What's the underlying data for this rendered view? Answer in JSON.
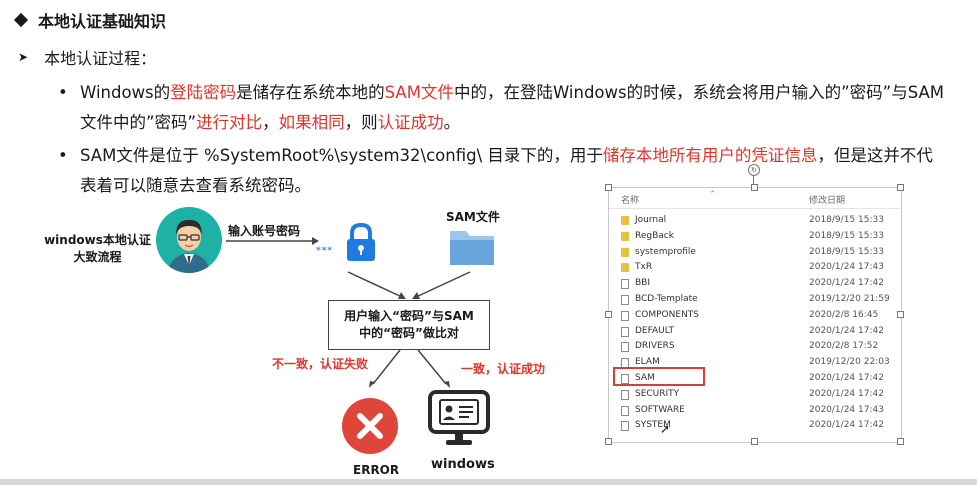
{
  "heading": "本地认证基础知识",
  "subheading": "本地认证过程：",
  "bullet1": {
    "p1": "Windows的",
    "p2": "登陆密码",
    "p3": "是储存在系统本地的",
    "p4": "SAM文件",
    "p5": "中的，在登陆Windows的时候，系统会将用户输入的”密码”与SAM文件中的”密码”",
    "p6": "进行对比",
    "p7": "，",
    "p8": "如果相同",
    "p9": "，则",
    "p10": "认证成功",
    "p11": "。"
  },
  "bullet2": {
    "p1": "SAM文件是位于 %SystemRoot%\\system32\\config\\ 目录下的，用于",
    "p2": "储存本地所有用户的凭证信息",
    "p3": "，但是这并不代表着可以随意去查看系统密码。"
  },
  "diagram": {
    "flow_label_1": "windows本地认证",
    "flow_label_2": "大致流程",
    "input_label": "输入账号密码",
    "password_dots": "***",
    "sam_label": "SAM文件",
    "compare_line1": "用户输入“密码”与SAM",
    "compare_line2": "中的“密码”做比对",
    "fail_label": "不一致，认证失败",
    "success_label": "一致，认证成功",
    "error_label": "ERROR",
    "windows_label": "windows"
  },
  "explorer": {
    "col_name": "名称",
    "col_date": "修改日期",
    "rows": [
      {
        "name": "Journal",
        "date": "2018/9/15 15:33",
        "type": "folder"
      },
      {
        "name": "RegBack",
        "date": "2018/9/15 15:33",
        "type": "folder"
      },
      {
        "name": "systemprofile",
        "date": "2018/9/15 15:33",
        "type": "folder"
      },
      {
        "name": "TxR",
        "date": "2020/1/24 17:43",
        "type": "folder"
      },
      {
        "name": "BBI",
        "date": "2020/1/24 17:42",
        "type": "file"
      },
      {
        "name": "BCD-Template",
        "date": "2019/12/20 21:59",
        "type": "file"
      },
      {
        "name": "COMPONENTS",
        "date": "2020/2/8 16:45",
        "type": "file"
      },
      {
        "name": "DEFAULT",
        "date": "2020/1/24 17:42",
        "type": "file"
      },
      {
        "name": "DRIVERS",
        "date": "2020/2/8 17:52",
        "type": "file"
      },
      {
        "name": "ELAM",
        "date": "2019/12/20 22:03",
        "type": "file"
      },
      {
        "name": "SAM",
        "date": "2020/1/24 17:42",
        "type": "file"
      },
      {
        "name": "SECURITY",
        "date": "2020/1/24 17:42",
        "type": "file"
      },
      {
        "name": "SOFTWARE",
        "date": "2020/1/24 17:43",
        "type": "file"
      },
      {
        "name": "SYSTEM",
        "date": "2020/1/24 17:42",
        "type": "file"
      }
    ]
  },
  "colors": {
    "accent_red": "#e0342d",
    "avatar_teal": "#1fb1a5",
    "lock_blue": "#1e7be0",
    "folder_yellow": "#e8c042"
  }
}
